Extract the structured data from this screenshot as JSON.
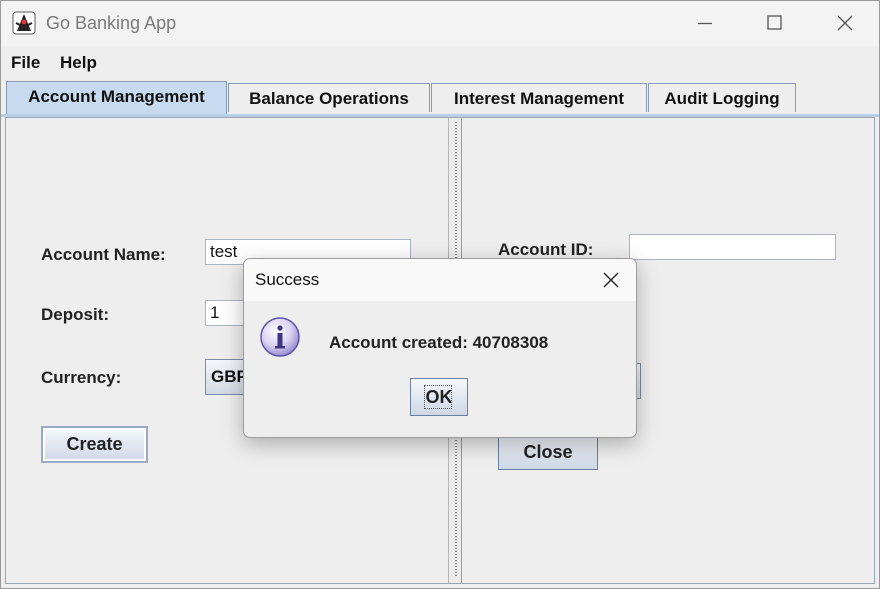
{
  "window": {
    "title": "Go Banking App",
    "icon": "java-duke-icon"
  },
  "menubar": {
    "items": [
      {
        "label": "File"
      },
      {
        "label": "Help"
      }
    ]
  },
  "tabs": [
    {
      "label": "Account Management",
      "active": true
    },
    {
      "label": "Balance Operations",
      "active": false
    },
    {
      "label": "Interest Management",
      "active": false
    },
    {
      "label": "Audit Logging",
      "active": false
    }
  ],
  "left_panel": {
    "account_name_label": "Account Name:",
    "account_name_value": "test",
    "deposit_label": "Deposit:",
    "deposit_value": "1",
    "currency_label": "Currency:",
    "currency_value": "GBP",
    "create_button": "Create"
  },
  "right_panel": {
    "account_id_label": "Account ID:",
    "account_id_value": "",
    "close_button": "Close"
  },
  "dialog": {
    "title": "Success",
    "icon": "info-icon",
    "message": "Account created: 40708308",
    "ok_button": "OK"
  },
  "colors": {
    "active_tab": "#c8daf0",
    "button_top": "#f5f7fb",
    "button_bottom": "#cfd8e6"
  }
}
